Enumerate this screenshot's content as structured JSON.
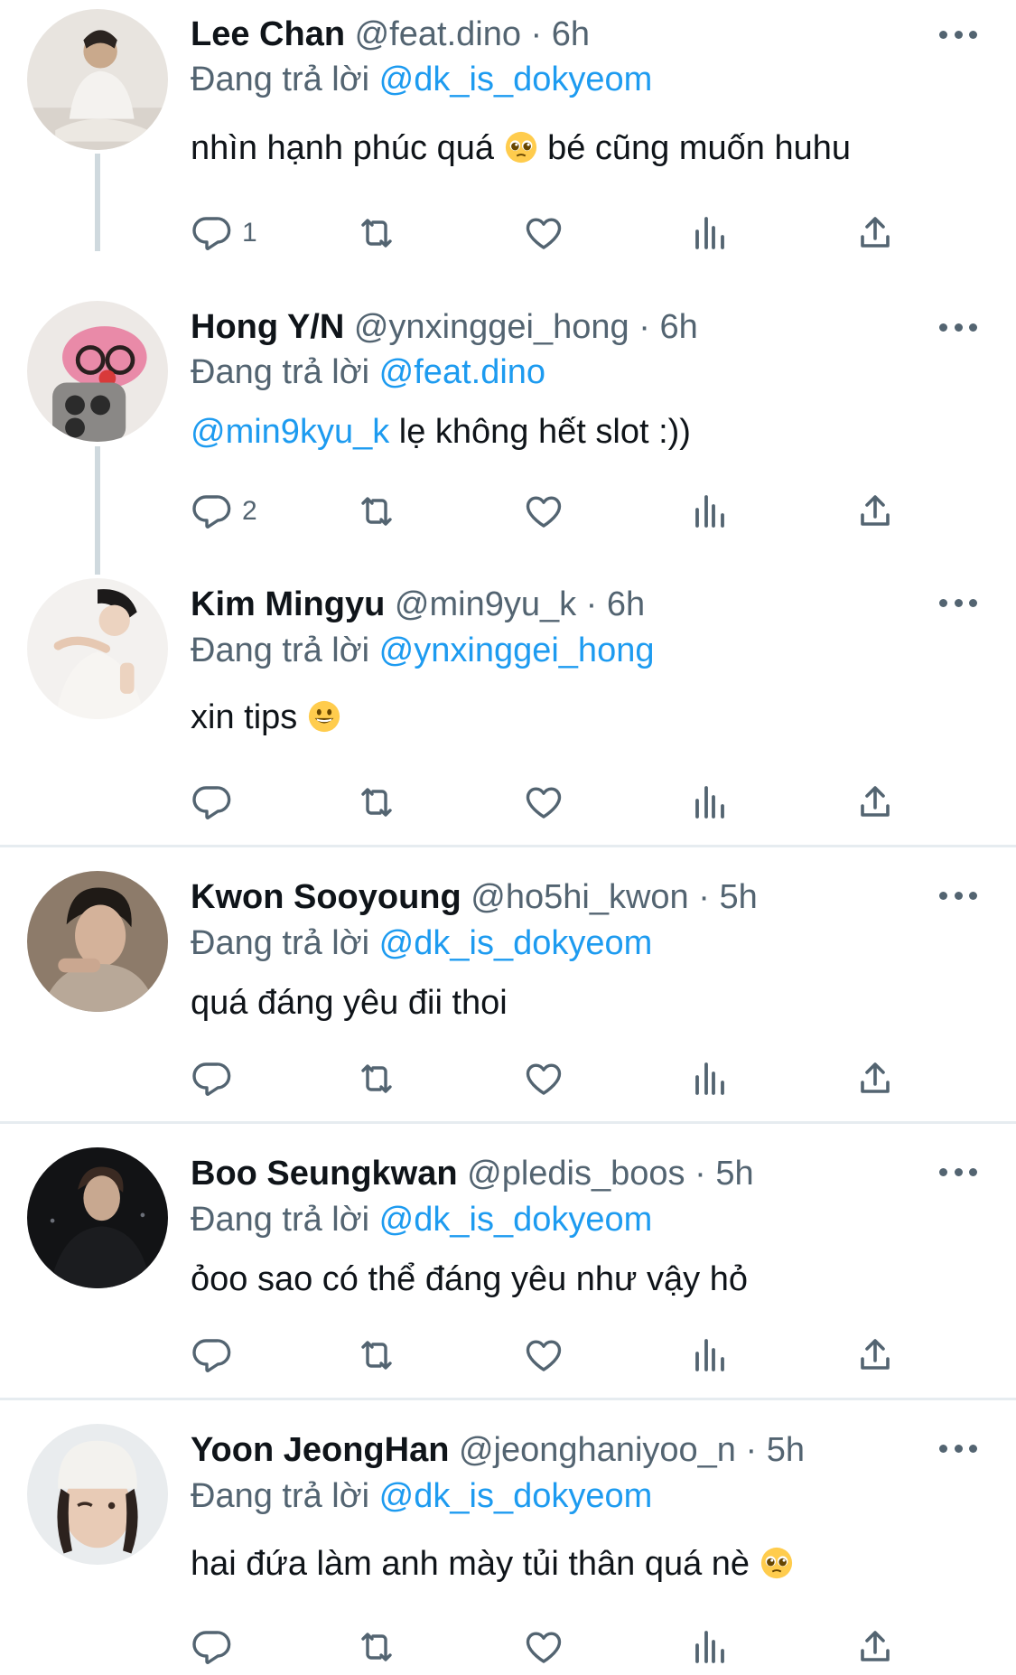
{
  "colors": {
    "text": "#0f1419",
    "secondary": "#536471",
    "accent": "#1d9bf0",
    "divider": "#e6ecf0",
    "thread_line": "#cfd9de"
  },
  "icons": {
    "reply": "reply-icon",
    "retweet": "retweet-icon",
    "like": "heart-icon",
    "views": "views-icon",
    "share": "share-icon",
    "more": "more-icon"
  },
  "tweets": [
    {
      "name": "Lee Chan",
      "handle": "@feat.dino",
      "dot": "·",
      "time": "6h",
      "replying_prefix": "Đang trả lời ",
      "replying_to": "@dk_is_dokyeom",
      "text": "nhìn hạnh phúc quá ",
      "text_after_emoji": " bé cũng muốn huhu",
      "emoji": "pleading-face",
      "reply_count": "1"
    },
    {
      "name": "Hong Y/N",
      "handle": "@ynxinggei_hong",
      "dot": "·",
      "time": "6h",
      "replying_prefix": "Đang trả lời ",
      "replying_to": "@feat.dino",
      "mention": "@min9kyu_k",
      "text": " lẹ không hết slot :))",
      "reply_count": "2"
    },
    {
      "name": "Kim Mingyu",
      "handle": "@min9yu_k",
      "dot": "·",
      "time": "6h",
      "replying_prefix": "Đang trả lời ",
      "replying_to": "@ynxinggei_hong",
      "text": "xin tips ",
      "emoji": "grinning-face"
    },
    {
      "name": "Kwon Sooyoung",
      "handle": "@ho5hi_kwon",
      "dot": "·",
      "time": "5h",
      "replying_prefix": "Đang trả lời ",
      "replying_to": "@dk_is_dokyeom",
      "text": "quá đáng yêu đii thoi"
    },
    {
      "name": "Boo Seungkwan",
      "handle": "@pledis_boos",
      "dot": "·",
      "time": "5h",
      "replying_prefix": "Đang trả lời ",
      "replying_to": "@dk_is_dokyeom",
      "text": "ỏoo sao có thể đáng yêu như vậy hỏ"
    },
    {
      "name": "Yoon JeongHan",
      "handle": "@jeonghaniyoo_n",
      "dot": "·",
      "time": "5h",
      "replying_prefix": "Đang trả lời ",
      "replying_to": "@dk_is_dokyeom",
      "text": "hai đứa làm anh mày tủi thân quá nè ",
      "emoji": "pleading-face"
    }
  ]
}
